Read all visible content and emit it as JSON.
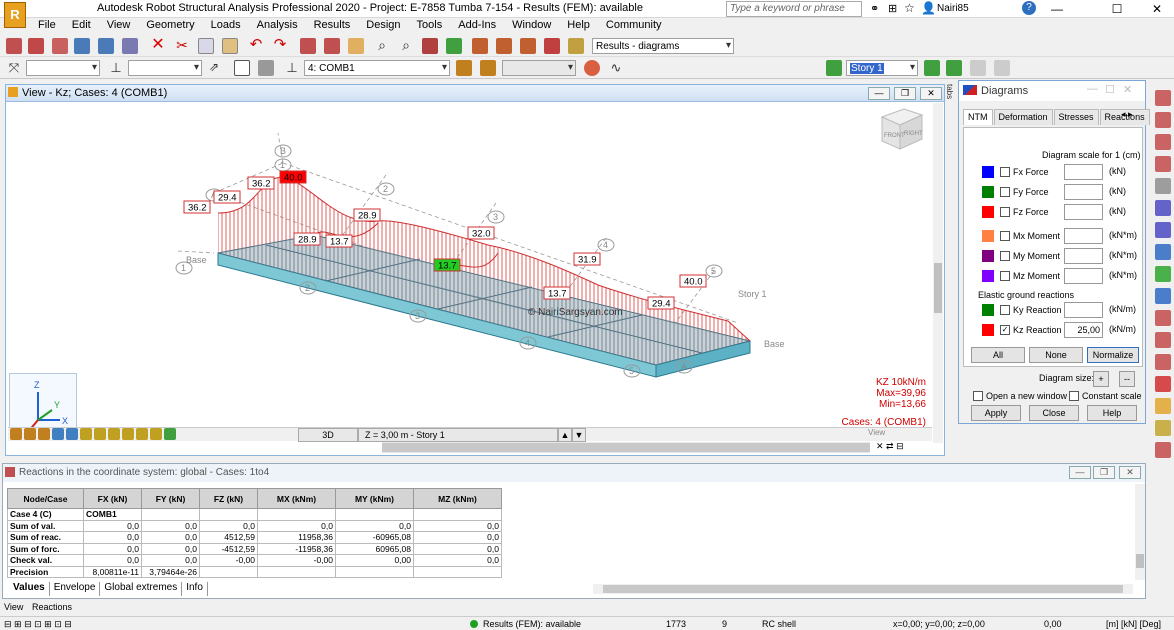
{
  "app": {
    "title": "Autodesk Robot Structural Analysis Professional 2020 - Project: E-7858 Tumba 7-154 - Results (FEM): available",
    "search_placeholder": "Type a keyword or phrase",
    "user": "Nairi85",
    "logo_text": "R"
  },
  "menu": [
    "File",
    "Edit",
    "View",
    "Geometry",
    "Loads",
    "Analysis",
    "Results",
    "Design",
    "Tools",
    "Add-Ins",
    "Window",
    "Help",
    "Community"
  ],
  "toolbar": {
    "results_combo": "Results - diagrams",
    "case_combo": "4: COMB1",
    "story_combo": "Story 1"
  },
  "view": {
    "title": "View - Kz; Cases: 4 (COMB1)",
    "mode_tab": "3D",
    "level_tab": "Z = 3,00 m - Story 1",
    "view_label": "View",
    "watermark": "© NairiSargsyan.com",
    "cube_front": "FRONT",
    "cube_right": "RIGHT",
    "legend": {
      "line1": "KZ  10kN/m",
      "line2": "Max=39,96",
      "line3": "Min=13,66",
      "cases": "Cases: 4 (COMB1)"
    },
    "axis": {
      "z": "Z",
      "y": "Y",
      "x": "X"
    },
    "grid_labels": [
      "A",
      "B",
      "1",
      "2",
      "3",
      "4",
      "5",
      "A",
      "1",
      "2",
      "3",
      "4",
      "5",
      "Base",
      "Base",
      "Story 1"
    ],
    "values": [
      "36.2",
      "40.0",
      "29.4",
      "36.2",
      "28.9",
      "28.9",
      "13.7",
      "32.0",
      "13.7",
      "31.9",
      "13.7",
      "40.0",
      "29.4"
    ]
  },
  "diagrams": {
    "title": "Diagrams",
    "tabs": [
      "NTM",
      "Deformation",
      "Stresses",
      "Reactions"
    ],
    "scale_label": "Diagram scale for 1  (cm)",
    "rows": [
      {
        "label": "Fx Force",
        "unit": "(kN)",
        "color": "#0000ff",
        "value": "",
        "checked": false
      },
      {
        "label": "Fy Force",
        "unit": "(kN)",
        "color": "#008000",
        "value": "",
        "checked": false
      },
      {
        "label": "Fz Force",
        "unit": "(kN)",
        "color": "#ff0000",
        "value": "",
        "checked": false
      },
      {
        "label": "Mx Moment",
        "unit": "(kN*m)",
        "color": "#ff8040",
        "value": "",
        "checked": false
      },
      {
        "label": "My Moment",
        "unit": "(kN*m)",
        "color": "#800080",
        "value": "",
        "checked": false
      },
      {
        "label": "Mz Moment",
        "unit": "(kN*m)",
        "color": "#8000ff",
        "value": "",
        "checked": false
      }
    ],
    "elastic_label": "Elastic ground reactions",
    "elastic_rows": [
      {
        "label": "Ky Reaction",
        "unit": "(kN/m)",
        "color": "#008000",
        "value": "",
        "checked": false
      },
      {
        "label": "Kz Reaction",
        "unit": "(kN/m)",
        "color": "#ff0000",
        "value": "25,00",
        "checked": true
      }
    ],
    "buttons": {
      "all": "All",
      "none": "None",
      "normalize": "Normalize",
      "apply": "Apply",
      "close": "Close",
      "help": "Help"
    },
    "size_label": "Diagram size:",
    "plus": "+",
    "minus": "--",
    "open_new": "Open a new window",
    "constant": "Constant scale"
  },
  "results": {
    "title": "Reactions in the coordinate system: global - Cases: 1to4",
    "columns": [
      "Node/Case",
      "FX (kN)",
      "FY (kN)",
      "FZ (kN)",
      "MX (kNm)",
      "MY (kNm)",
      "MZ (kNm)"
    ],
    "rows": [
      [
        "Case 4 (C)",
        "COMB1",
        "",
        "",
        "",
        "",
        ""
      ],
      [
        "Sum of val.",
        "0,0",
        "0,0",
        "0,0",
        "0,0",
        "0,0",
        "0,0"
      ],
      [
        "Sum of reac.",
        "0,0",
        "0,0",
        "4512,59",
        "11958,36",
        "-60965,08",
        "0,0"
      ],
      [
        "Sum of forc.",
        "0,0",
        "0,0",
        "-4512,59",
        "-11958,36",
        "60965,08",
        "0,0"
      ],
      [
        "Check val.",
        "0,0",
        "0,0",
        "-0,00",
        "-0,00",
        "0,00",
        "0,0"
      ],
      [
        "Precision",
        "8,00811e-11",
        "3,79464e-26",
        "",
        "",
        "",
        ""
      ]
    ],
    "tabs": [
      "Values",
      "Envelope",
      "Global extremes",
      "Info"
    ]
  },
  "bottom_tabs": [
    "View",
    "Reactions"
  ],
  "status": {
    "results": "Results (FEM): available",
    "num1": "1773",
    "num2": "9",
    "shell": "RC shell",
    "coords": "x=0,00; y=0,00; z=0,00",
    "val": "0,00",
    "units": "[m] [kN] [Deg]"
  }
}
